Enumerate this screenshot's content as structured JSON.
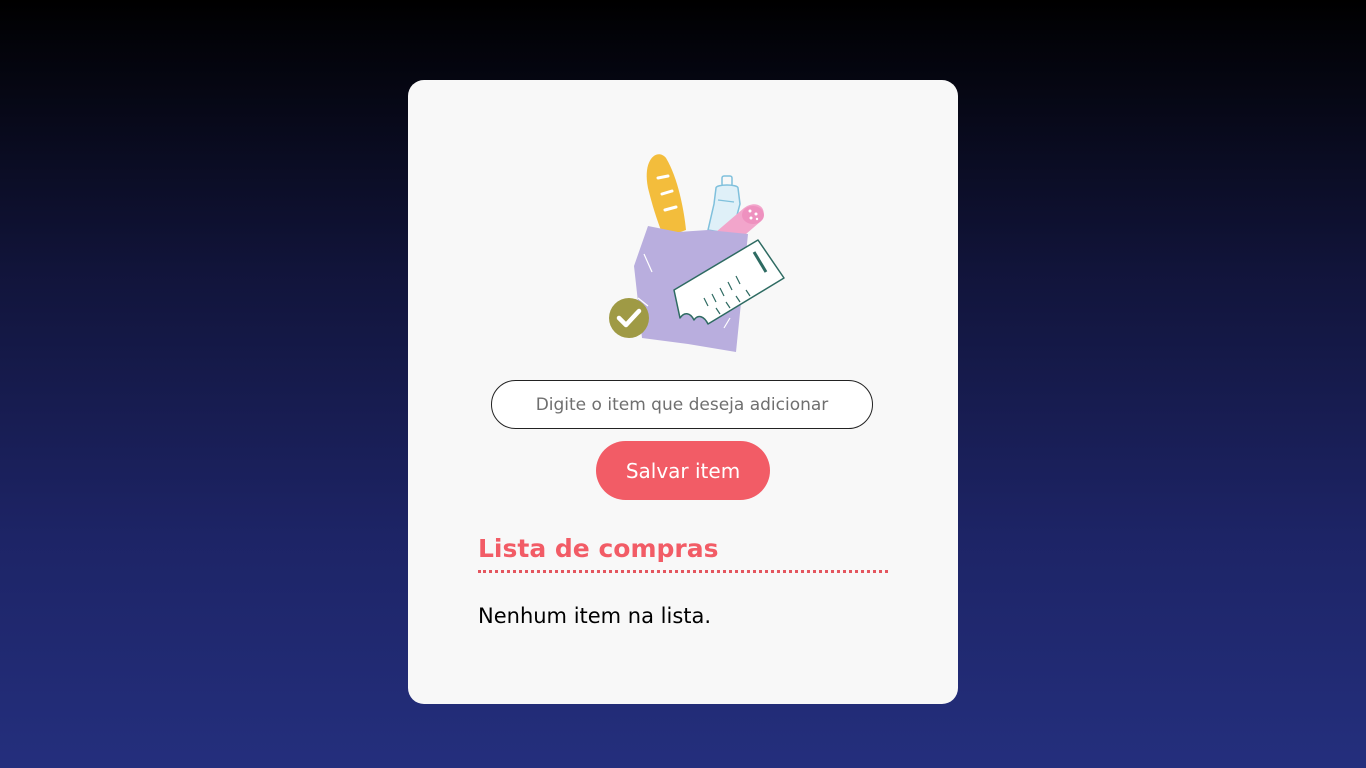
{
  "form": {
    "input_value": "",
    "input_placeholder": "Digite o item que deseja adicionar",
    "save_label": "Salvar item"
  },
  "list": {
    "title": "Lista de compras",
    "empty_message": "Nenhum item na lista.",
    "items": []
  },
  "illustration": {
    "icon": "shopping-bag-groceries-icon",
    "check_icon": "check-circle-icon",
    "receipt_icon": "receipt-icon"
  },
  "colors": {
    "accent": "#f25c66",
    "card_background": "#f8f8f8",
    "background_top": "#000000",
    "background_bottom": "#242f7d",
    "bag": "#b9aede",
    "bread": "#f3bd3c",
    "check_badge": "#9f9a45"
  }
}
